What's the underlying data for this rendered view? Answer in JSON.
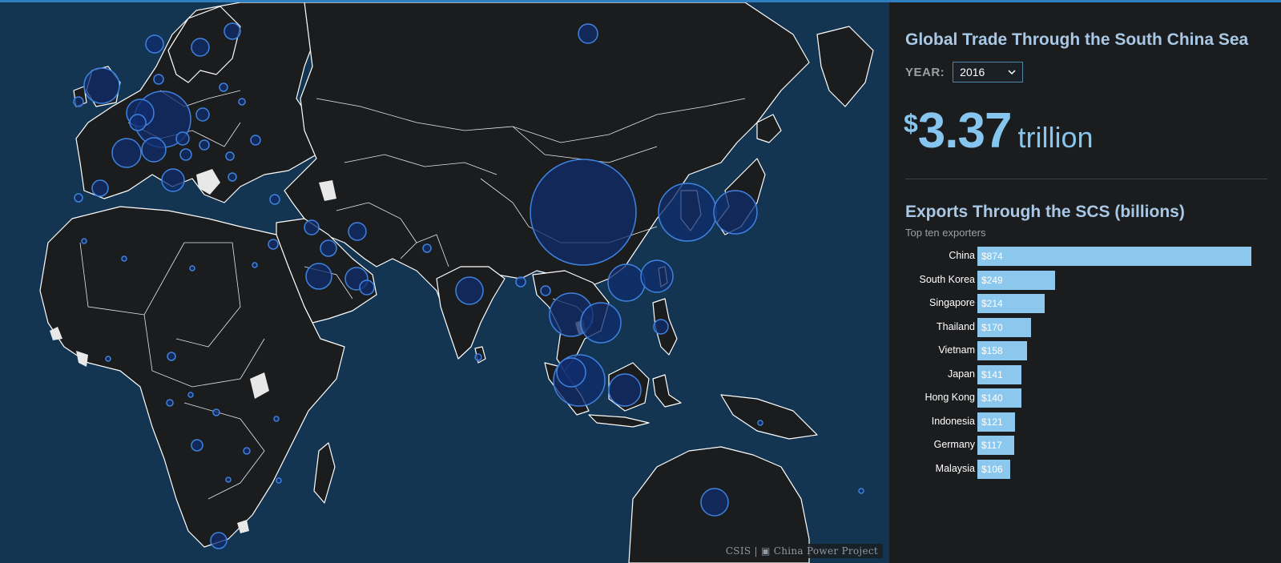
{
  "colors": {
    "ocean": "#133551",
    "land": "#1b1c1e",
    "border": "#ffffff",
    "bubble_fill": "#102c6e",
    "bubble_stroke": "#3e82e0",
    "bar": "#8cc8ee",
    "accent": "#86c5ee"
  },
  "map": {
    "credit": "CSIS | ▣ China Power Project"
  },
  "panel": {
    "title": "Global Trade Through the South China Sea",
    "year_label": "YEAR:",
    "year_value": "2016",
    "year_icon": "chevron-down-icon",
    "total": {
      "currency": "$",
      "value": "3.37",
      "unit": "trillion"
    },
    "exports_title": "Exports Through the SCS (billions)",
    "exports_caption": "Top ten exporters"
  },
  "chart_data": {
    "type": "bar",
    "orientation": "horizontal",
    "title": "Exports Through the SCS (billions)",
    "categories": [
      "China",
      "South Korea",
      "Singapore",
      "Thailand",
      "Vietnam",
      "Japan",
      "Hong Kong",
      "Indonesia",
      "Germany",
      "Malaysia"
    ],
    "values": [
      874,
      249,
      214,
      170,
      158,
      141,
      140,
      121,
      117,
      106
    ],
    "value_labels": [
      "$874",
      "$249",
      "$214",
      "$170",
      "$158",
      "$141",
      "$140",
      "$121",
      "$117",
      "$106"
    ]
  }
}
